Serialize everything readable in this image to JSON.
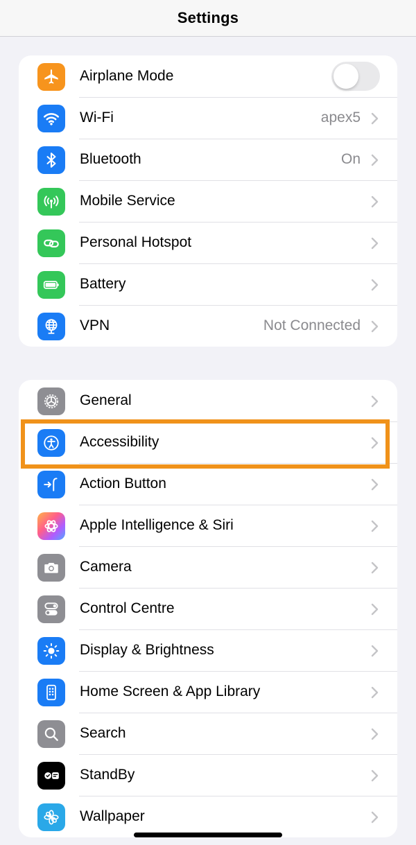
{
  "nav": {
    "title": "Settings"
  },
  "colors": {
    "background": "#f2f2f7",
    "highlight": "#f0921a",
    "airplane": "#f7941d",
    "wifi": "#1a7cf5",
    "bluetooth": "#1a7cf5",
    "mobile": "#34c759",
    "hotspot": "#34c759",
    "battery": "#34c759",
    "vpn": "#1a7cf5",
    "general": "#8e8e93",
    "accessibility": "#1a7cf5",
    "action": "#1a7cf5",
    "camera": "#8e8e93",
    "control": "#8e8e93",
    "display": "#1a7cf5",
    "homescreen": "#1a7cf5",
    "search": "#8e8e93",
    "standby": "#000000",
    "wallpaper": "#2aa8e8"
  },
  "groups": {
    "connectivity": [
      {
        "label": "Airplane Mode",
        "icon": "airplane-icon",
        "toggle": false
      },
      {
        "label": "Wi-Fi",
        "icon": "wifi-icon",
        "value": "apex5"
      },
      {
        "label": "Bluetooth",
        "icon": "bluetooth-icon",
        "value": "On"
      },
      {
        "label": "Mobile Service",
        "icon": "antenna-icon",
        "value": ""
      },
      {
        "label": "Personal Hotspot",
        "icon": "link-icon",
        "value": ""
      },
      {
        "label": "Battery",
        "icon": "battery-icon",
        "value": ""
      },
      {
        "label": "VPN",
        "icon": "globe-icon",
        "value": "Not Connected"
      }
    ],
    "system": [
      {
        "label": "General",
        "icon": "gear-icon"
      },
      {
        "label": "Accessibility",
        "icon": "accessibility-icon",
        "highlighted": true
      },
      {
        "label": "Action Button",
        "icon": "action-button-icon"
      },
      {
        "label": "Apple Intelligence & Siri",
        "icon": "siri-icon"
      },
      {
        "label": "Camera",
        "icon": "camera-icon"
      },
      {
        "label": "Control Centre",
        "icon": "switches-icon"
      },
      {
        "label": "Display & Brightness",
        "icon": "sun-icon"
      },
      {
        "label": "Home Screen & App Library",
        "icon": "phone-grid-icon"
      },
      {
        "label": "Search",
        "icon": "search-icon"
      },
      {
        "label": "StandBy",
        "icon": "standby-icon"
      },
      {
        "label": "Wallpaper",
        "icon": "flower-icon"
      }
    ]
  }
}
